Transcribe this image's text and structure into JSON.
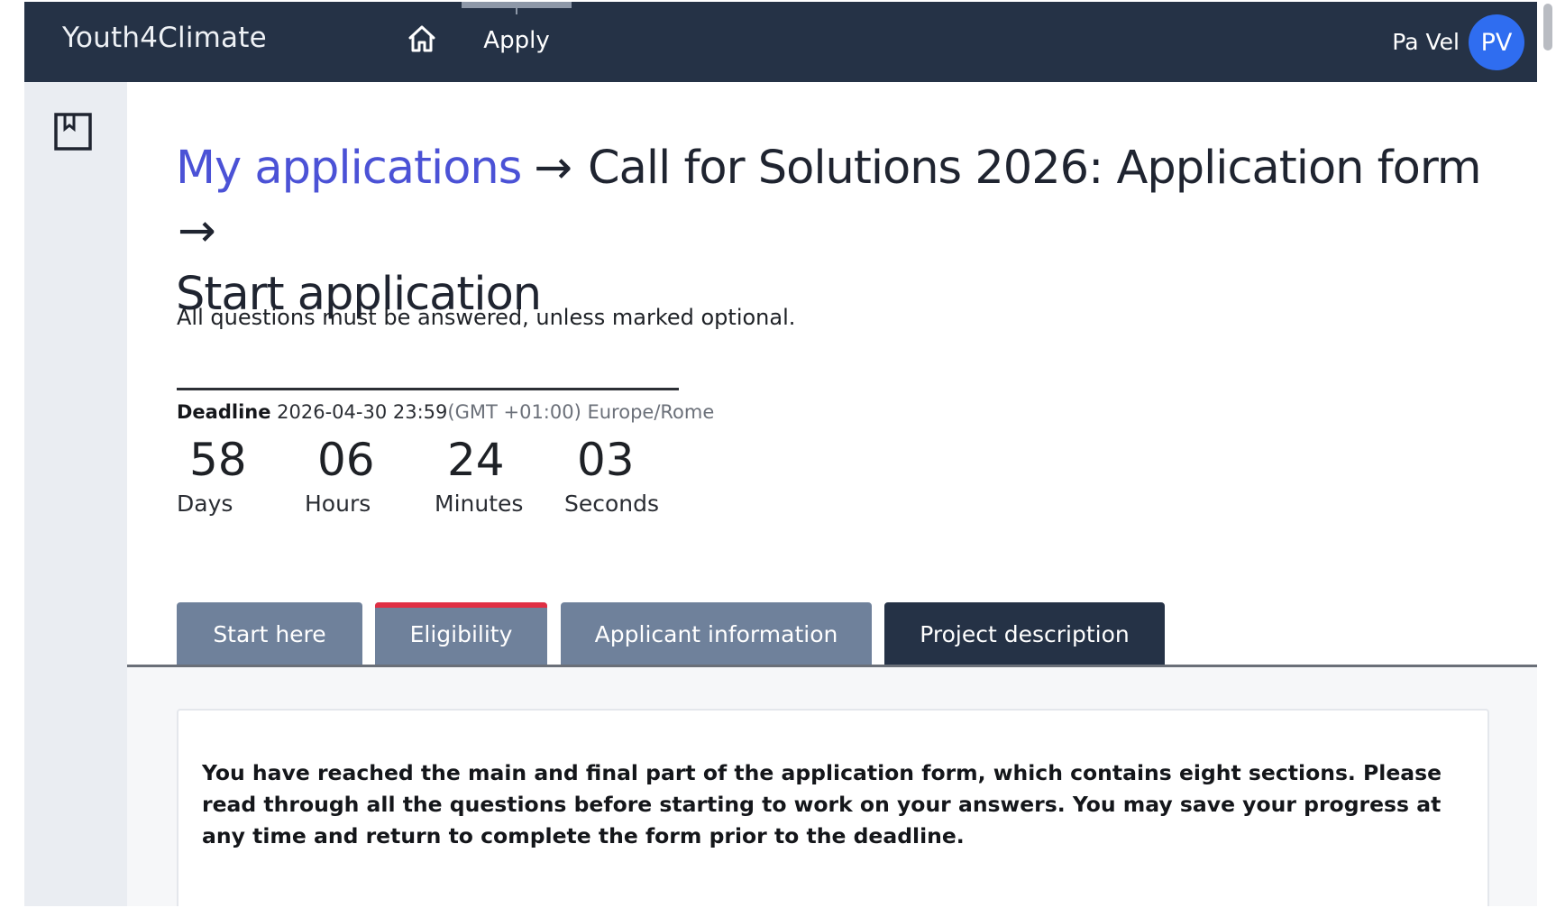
{
  "app": {
    "brand": "Youth4Climate"
  },
  "nav": {
    "home_icon": "home-icon",
    "apply_label": "Apply"
  },
  "user": {
    "name": "Pa Vel",
    "initials": "PV",
    "avatar_color": "#2f6df0"
  },
  "sidebar": {
    "bookmark_icon": "bookmark-icon"
  },
  "breadcrumb": {
    "link": "My applications",
    "arrow": "→",
    "current": "Call for Solutions 2026: Application form",
    "arrow2": "→",
    "page": "Start application"
  },
  "instructions": "All questions must be answered, unless marked optional.",
  "deadline": {
    "label": "Deadline",
    "date": "2026-04-30 23:59",
    "timezone": "(GMT +01:00) Europe/Rome"
  },
  "countdown": [
    {
      "value": "58",
      "unit": "Days"
    },
    {
      "value": "06",
      "unit": "Hours"
    },
    {
      "value": "24",
      "unit": "Minutes"
    },
    {
      "value": "03",
      "unit": "Seconds"
    }
  ],
  "tabs": [
    {
      "label": "Start here",
      "active": false
    },
    {
      "label": "Eligibility",
      "active": false,
      "flag": "error"
    },
    {
      "label": "Applicant information",
      "active": false
    },
    {
      "label": "Project description",
      "active": true
    }
  ],
  "colors": {
    "nav_bg": "#253246",
    "tab_inactive": "#6f819b",
    "tab_active": "#253246",
    "link": "#4b52d6",
    "error_accent": "#e02f44"
  },
  "card": {
    "text": "You have reached the main and final part of the application form, which contains eight sections. Please read through all the questions before starting to work on your answers. You may save your progress at any time and return to complete the form prior to the deadline."
  }
}
